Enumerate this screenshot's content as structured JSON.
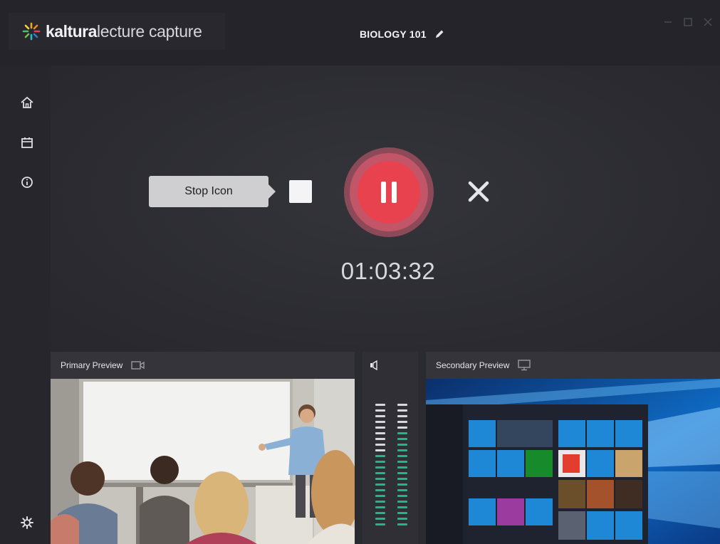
{
  "app": {
    "brand_bold": "kaltura",
    "brand_light": "lecture capture",
    "title": "BIOLOGY 101"
  },
  "icons": {
    "brand": "kaltura-star-icon",
    "edit": "pencil-icon",
    "minimize": "minimize-icon",
    "maximize": "maximize-icon",
    "close": "close-icon",
    "home": "home-icon",
    "calendar": "calendar-icon",
    "info": "info-icon",
    "settings": "gear-icon",
    "camera": "camera-icon",
    "monitor": "monitor-icon",
    "speaker": "speaker-icon"
  },
  "recording": {
    "tooltip": "Stop Icon",
    "timer": "01:03:32",
    "state": "recording"
  },
  "previews": {
    "primary_label": "Primary Preview",
    "secondary_label": "Secondary Preview"
  },
  "audio": {
    "left_level": 0.6,
    "right_level": 0.75
  },
  "colors": {
    "record_red": "#e8424f",
    "record_ring": "#c25568",
    "meter_active": "#22b58a",
    "meter_idle": "#d8d8dc"
  }
}
